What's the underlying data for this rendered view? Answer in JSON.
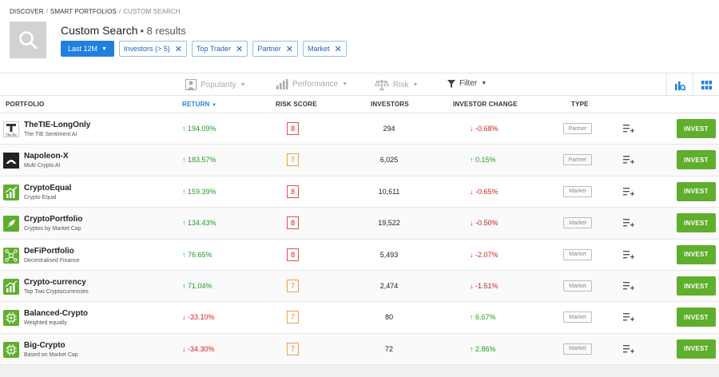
{
  "breadcrumb": {
    "items": [
      "DISCOVER",
      "SMART PORTFOLIOS"
    ],
    "current": "CUSTOM SEARCH"
  },
  "header": {
    "title": "Custom Search",
    "count": "• 8 results"
  },
  "chips": {
    "period": "Last 12M",
    "filters": [
      "Investors (> 5)",
      "Top Trader",
      "Partner",
      "Market"
    ]
  },
  "toolbar": {
    "popularity": "Popularity",
    "performance": "Performance",
    "risk": "Risk",
    "filter": "Filter"
  },
  "columns": {
    "portfolio": "PORTFOLIO",
    "return": "RETURN",
    "risk": "RISK SCORE",
    "investors": "INVESTORS",
    "change": "INVESTOR CHANGE",
    "type": "TYPE"
  },
  "invest_label": "INVEST",
  "rows": [
    {
      "name": "TheTIE-LongOnly",
      "sub": "The TIE Sentiment AI",
      "logo_text": "TheTie",
      "ret": "↑ 194.09%",
      "ret_dir": "pos",
      "risk": "8",
      "risk_level": "high",
      "investors": "294",
      "change": "↓ -0.68%",
      "change_dir": "neg",
      "type": "Partner",
      "logo_color": "#ffffff",
      "logo_kind": "tie"
    },
    {
      "name": "Napoleon-X",
      "sub": "Multi Crypto AI",
      "ret": "↑ 183.57%",
      "ret_dir": "pos",
      "risk": "7",
      "risk_level": "mid",
      "investors": "6,025",
      "change": "↑ 0.15%",
      "change_dir": "pos",
      "type": "Partner",
      "logo_color": "#222222",
      "logo_kind": "napoleon"
    },
    {
      "name": "CryptoEqual",
      "sub": "Crypto Equal",
      "ret": "↑ 159.39%",
      "ret_dir": "pos",
      "risk": "8",
      "risk_level": "high",
      "investors": "10,611",
      "change": "↓ -0.65%",
      "change_dir": "neg",
      "type": "Market",
      "logo_color": "#5fae2d",
      "logo_kind": "bars"
    },
    {
      "name": "CryptoPortfolio",
      "sub": "Cryptos by Market Cap",
      "ret": "↑ 134.43%",
      "ret_dir": "pos",
      "risk": "8",
      "risk_level": "high",
      "investors": "19,522",
      "change": "↓ -0.50%",
      "change_dir": "neg",
      "type": "Market",
      "logo_color": "#5fae2d",
      "logo_kind": "rocket"
    },
    {
      "name": "DeFiPortfolio",
      "sub": "Decentralised Finance",
      "ret": "↑ 76.65%",
      "ret_dir": "pos",
      "risk": "8",
      "risk_level": "high",
      "investors": "5,493",
      "change": "↓ -2.07%",
      "change_dir": "neg",
      "type": "Market",
      "logo_color": "#5fae2d",
      "logo_kind": "network"
    },
    {
      "name": "Crypto-currency",
      "sub": "Top Two Cryptocurrencies",
      "ret": "↑ 71.04%",
      "ret_dir": "pos",
      "risk": "7",
      "risk_level": "mid",
      "investors": "2,474",
      "change": "↓ -1.51%",
      "change_dir": "neg",
      "type": "Market",
      "logo_color": "#5fae2d",
      "logo_kind": "bars"
    },
    {
      "name": "Balanced-Crypto",
      "sub": "Weighted equally",
      "ret": "↓ -33.10%",
      "ret_dir": "neg",
      "risk": "7",
      "risk_level": "mid",
      "investors": "80",
      "change": "↑ 6.67%",
      "change_dir": "pos",
      "type": "Market",
      "logo_color": "#5fae2d",
      "logo_kind": "chip"
    },
    {
      "name": "Big-Crypto",
      "sub": "Based on Market Cap",
      "ret": "↓ -34.30%",
      "ret_dir": "neg",
      "risk": "7",
      "risk_level": "mid",
      "investors": "72",
      "change": "↑ 2.86%",
      "change_dir": "pos",
      "type": "Market",
      "logo_color": "#5fae2d",
      "logo_kind": "chip"
    }
  ],
  "colors": {
    "accent": "#1f80e0",
    "invest": "#5fae2d",
    "positive": "#1e9c24",
    "negative": "#d21f1f"
  }
}
